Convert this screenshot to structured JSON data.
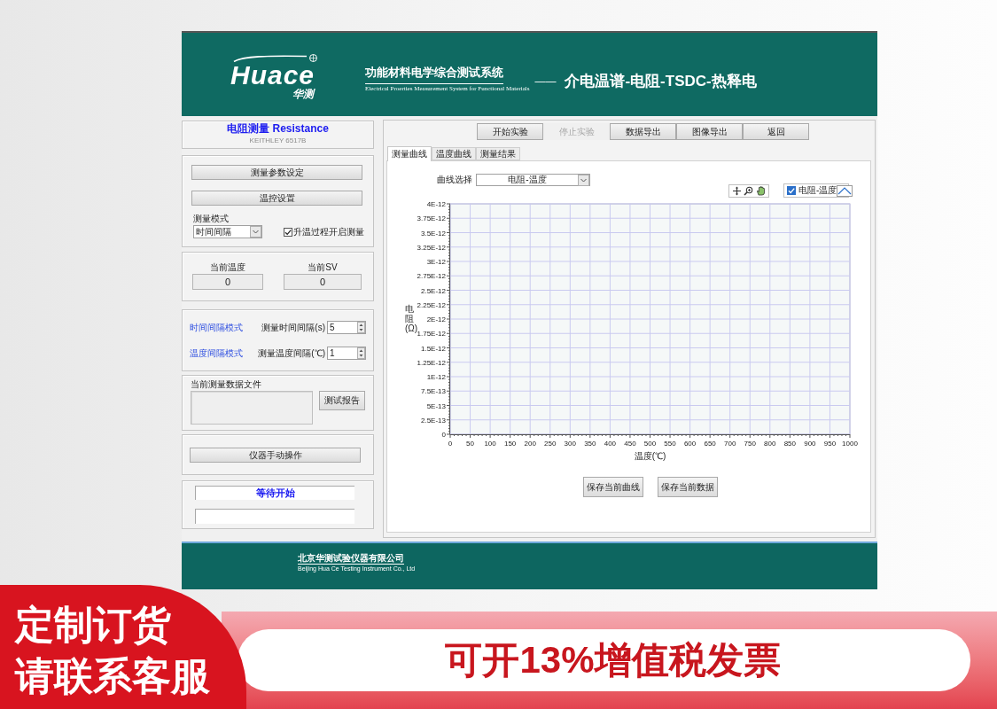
{
  "header": {
    "logo": {
      "text": "Huace",
      "subtext": "华测"
    },
    "title": "功能材料电学综合测试系统",
    "subtitle": "Electrical Proerties Measurement System for Functional Materials",
    "separator": "——",
    "modes": "介电温谱-电阻-TSDC-热释电"
  },
  "left_panel": {
    "module": {
      "title": "电阻测量 Resistance",
      "instrument": "KEITHLEY 6517B"
    },
    "setup": {
      "buttons": [
        "测量参数设定",
        "温控设置"
      ],
      "mode_label": "测量模式",
      "mode_select": "时间间隔",
      "heating_option": {
        "label": "升温过程开启测量",
        "checked": true
      }
    },
    "readings": [
      {
        "label": "当前温度",
        "value": "0"
      },
      {
        "label": "当前SV",
        "value": "0"
      }
    ],
    "intervals": [
      {
        "mode": "时间间隔模式",
        "label": "测量时间间隔(s)",
        "value": "5"
      },
      {
        "mode": "温度间隔模式",
        "label": "测量温度间隔(℃)",
        "value": "1"
      }
    ],
    "data_file": {
      "label": "当前测量数据文件",
      "button": "测试报告"
    },
    "manual": {
      "button": "仪器手动操作"
    },
    "status": {
      "message": "等待开始"
    }
  },
  "right_panel": {
    "toolbar": [
      {
        "label": "开始实验",
        "disabled": false
      },
      {
        "label": "停止实验",
        "disabled": true
      },
      {
        "label": "数据导出",
        "disabled": false
      },
      {
        "label": "图像导出",
        "disabled": false
      },
      {
        "label": "返回",
        "disabled": false
      }
    ],
    "tabs": [
      {
        "label": "测量曲线",
        "selected": true
      },
      {
        "label": "温度曲线",
        "selected": false
      },
      {
        "label": "测量结果",
        "selected": false
      }
    ],
    "curve_select": {
      "label": "曲线选择",
      "value": "电阻-温度"
    },
    "legend": {
      "label": "电阻-温度",
      "checked": true
    },
    "chart_data": {
      "type": "line",
      "grid": true,
      "xlabel": "温度(℃)",
      "ylabel": "电阻(Ω)",
      "xlim": [
        0,
        1000
      ],
      "ylim": [
        0,
        4e-12
      ],
      "xticks": [
        0,
        50,
        100,
        150,
        200,
        250,
        300,
        350,
        400,
        450,
        500,
        550,
        600,
        650,
        700,
        750,
        800,
        850,
        900,
        950,
        1000
      ],
      "yticks": [
        {
          "value": 0,
          "label": "0"
        },
        {
          "value": 2.5e-13,
          "label": "2.5E-13"
        },
        {
          "value": 5e-13,
          "label": "5E-13"
        },
        {
          "value": 7.5e-13,
          "label": "7.5E-13"
        },
        {
          "value": 1e-12,
          "label": "1E-12"
        },
        {
          "value": 1.25e-12,
          "label": "1.25E-12"
        },
        {
          "value": 1.5e-12,
          "label": "1.5E-12"
        },
        {
          "value": 1.75e-12,
          "label": "1.75E-12"
        },
        {
          "value": 2e-12,
          "label": "2E-12"
        },
        {
          "value": 2.25e-12,
          "label": "2.25E-12"
        },
        {
          "value": 2.5e-12,
          "label": "2.5E-12"
        },
        {
          "value": 2.75e-12,
          "label": "2.75E-12"
        },
        {
          "value": 3e-12,
          "label": "3E-12"
        },
        {
          "value": 3.25e-12,
          "label": "3.25E-12"
        },
        {
          "value": 3.5e-12,
          "label": "3.5E-12"
        },
        {
          "value": 3.75e-12,
          "label": "3.75E-12"
        },
        {
          "value": 4e-12,
          "label": "4E-12"
        }
      ]
    },
    "buttons": [
      "保存当前曲线",
      "保存当前数据"
    ]
  },
  "footer": {
    "company": "北京华测试验仪器有限公司",
    "company_en": "Beijing Hua Ce Testing Instrument Co., Ltd"
  },
  "promo": {
    "badge_lines": [
      "定制订货",
      "请联系客服"
    ],
    "banner": "可开13%增值税发票"
  }
}
